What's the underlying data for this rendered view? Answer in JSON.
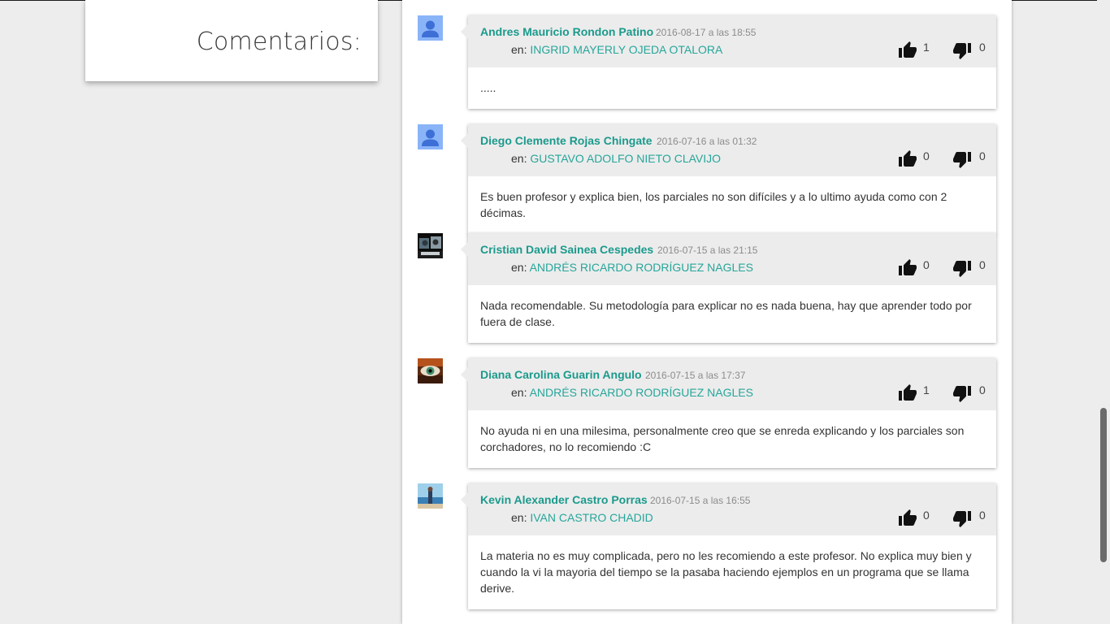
{
  "section": {
    "title": "Comentarios:"
  },
  "en_prefix": "en: ",
  "comments": [
    {
      "author": "Andres Mauricio Rondon Patino",
      "date": "2016-08-17 a las 18:55",
      "professor": "INGRID MAYERLY OJEDA OTALORA",
      "likes": "1",
      "dislikes": "0",
      "text": ".....",
      "avatar": "default-user-icon"
    },
    {
      "author": "Diego Clemente Rojas Chingate",
      "date": "2016-07-16 a las 01:32",
      "professor": "GUSTAVO ADOLFO NIETO CLAVIJO",
      "likes": "0",
      "dislikes": "0",
      "text": "Es buen profesor y explica bien, los parciales no son difíciles y a lo ultimo ayuda como con 2 décimas.",
      "avatar": "default-user-icon"
    },
    {
      "author": "Cristian David Sainea Cespedes",
      "date": "2016-07-15 a las 21:15",
      "professor": "ANDRÉS RICARDO RODRÍGUEZ NAGLES",
      "likes": "0",
      "dislikes": "0",
      "text": "Nada recomendable. Su metodología para explicar no es nada buena, hay que aprender todo por fuera de clase.",
      "avatar": "photo-avatar"
    },
    {
      "author": "Diana Carolina Guarin Angulo",
      "date": "2016-07-15 a las 17:37",
      "professor": "ANDRÉS RICARDO RODRÍGUEZ NAGLES",
      "likes": "1",
      "dislikes": "0",
      "text": "No ayuda ni en una milesima, personalmente creo que se enreda explicando y los parciales son corchadores, no lo recomiendo :C",
      "avatar": "eye-photo-avatar"
    },
    {
      "author": "Kevin Alexander Castro Porras",
      "date": "2016-07-15 a las 16:55",
      "professor": "IVAN CASTRO CHADID",
      "likes": "0",
      "dislikes": "0",
      "text": "La materia no es muy complicada, pero no les recomiendo a este profesor. No explica muy bien y cuando la vi la mayoria del tiempo se la pasaba haciendo ejemplos en un programa que se llama derive.",
      "avatar": "beach-photo-avatar"
    }
  ],
  "colors": {
    "author": "#1b9a8c",
    "professor_link": "#26a69a",
    "card_header": "#ececec",
    "page_background": "#ededed"
  },
  "icons": [
    "thumbs-up-icon",
    "thumbs-down-icon"
  ]
}
